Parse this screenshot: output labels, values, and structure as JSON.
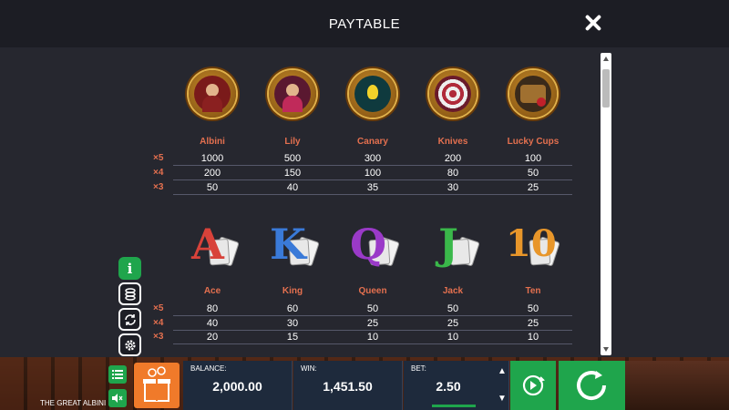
{
  "header": {
    "title": "PAYTABLE"
  },
  "paytable": {
    "multipliers": [
      "×5",
      "×4",
      "×3"
    ],
    "high_symbols": [
      {
        "name": "Albini",
        "icon": "ringmaster-medallion-icon",
        "pays": [
          "1000",
          "200",
          "50"
        ]
      },
      {
        "name": "Lily",
        "icon": "acrobat-lady-medallion-icon",
        "pays": [
          "500",
          "150",
          "40"
        ]
      },
      {
        "name": "Canary",
        "icon": "canary-medallion-icon",
        "pays": [
          "300",
          "100",
          "35"
        ]
      },
      {
        "name": "Knives",
        "icon": "knife-wheel-medallion-icon",
        "pays": [
          "200",
          "80",
          "30"
        ]
      },
      {
        "name": "Lucky Cups",
        "icon": "lucky-cups-medallion-icon",
        "pays": [
          "100",
          "50",
          "25"
        ]
      }
    ],
    "low_symbols": [
      {
        "name": "Ace",
        "letter": "A",
        "color": "#d8423a",
        "pays": [
          "80",
          "40",
          "20"
        ]
      },
      {
        "name": "King",
        "letter": "K",
        "color": "#3a7ad8",
        "pays": [
          "60",
          "30",
          "15"
        ]
      },
      {
        "name": "Queen",
        "letter": "Q",
        "color": "#9a3ac8",
        "pays": [
          "50",
          "25",
          "10"
        ]
      },
      {
        "name": "Jack",
        "letter": "J",
        "color": "#3ab84a",
        "pays": [
          "50",
          "25",
          "10"
        ]
      },
      {
        "name": "Ten",
        "letter": "10",
        "color": "#e8962a",
        "pays": [
          "50",
          "25",
          "10"
        ]
      }
    ]
  },
  "side_tools": [
    "info-icon",
    "coins-icon",
    "autoplay-settings-icon",
    "settings-gear-icon"
  ],
  "footer": {
    "game_name": "THE GREAT ALBINI",
    "balance_label": "BALANCE:",
    "balance": "2,000.00",
    "win_label": "WIN:",
    "win": "1,451.50",
    "bet_label": "BET:",
    "bet": "2.50",
    "bet_up": "▲",
    "bet_down": "▼"
  },
  "colors": {
    "accent": "#1fa54c",
    "label": "#e4704f",
    "gift": "#f07a2a"
  }
}
